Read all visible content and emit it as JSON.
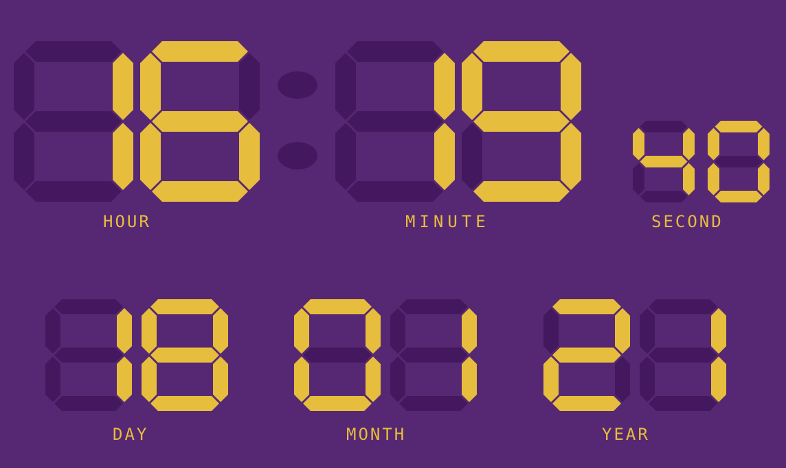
{
  "colors": {
    "background": "#562873",
    "segment_on": "#e6bd3d",
    "segment_off": "#44185e"
  },
  "time": {
    "hour": "16",
    "minute": "19",
    "second": "40"
  },
  "date": {
    "day": "18",
    "month": "01",
    "year": "21"
  },
  "labels": {
    "hour": "HOUR",
    "minute": "MINUTE",
    "second": "SECOND",
    "day": "DAY",
    "month": "MONTH",
    "year": "YEAR"
  }
}
